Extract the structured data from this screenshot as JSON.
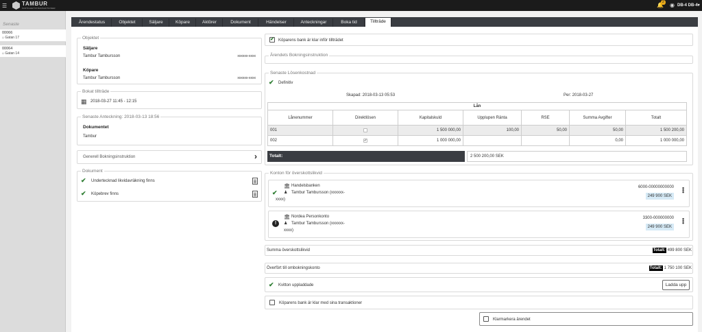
{
  "topbar": {
    "logo_text": "TAMBUR",
    "logo_sub": "FASTIGHETSTRANSAKTIONER",
    "notification_count": "2",
    "user_name": "DB-4 DB-4"
  },
  "sidebar": {
    "title": "Senaste",
    "items": [
      {
        "number": "00066",
        "address": "Gatan 17"
      },
      {
        "number": "00064",
        "address": "Gatan 14"
      }
    ]
  },
  "tabs": [
    {
      "label": "Ärendestatus"
    },
    {
      "label": "Objektet"
    },
    {
      "label": "Säljare"
    },
    {
      "label": "Köpare"
    },
    {
      "label": "Aktörer"
    },
    {
      "label": "Dokument"
    },
    {
      "label": "Händelser"
    },
    {
      "label": "Anteckningar"
    },
    {
      "label": "Boka tid"
    },
    {
      "label": "Tillträde",
      "active": true
    }
  ],
  "objektet": {
    "legend": "Objektet",
    "seller_label": "Säljare",
    "seller_name": "Tambur Tambursson",
    "seller_id": "xxxxxx-xxxx",
    "buyer_label": "Köpare",
    "buyer_name": "Tambur Tambursson",
    "buyer_id": "xxxxxx-xxxx"
  },
  "bokat": {
    "legend": "Bokat tillträde",
    "value": "2018-03-27 11:45 - 12:15"
  },
  "anteckning": {
    "legend": "Senaste Anteckning: 2018-03-13 18:56",
    "title": "Dokumentet",
    "text": "Tambur"
  },
  "generell": {
    "label": "Generell Bokningsinstruktion"
  },
  "dokument": {
    "legend": "Dokument",
    "items": [
      {
        "label": "Undertecknad likvidavräkning finns"
      },
      {
        "label": "Köpebrev finns"
      }
    ]
  },
  "right": {
    "bank_ready_label": "Köparens bank är klar inför tillträdet",
    "arendets_label": "Ärendets Bokningsinstruktion",
    "losen": {
      "legend": "Senaste Lösenkostnad",
      "status": "Definitiv",
      "created": "Skapad: 2018-03-13 05:53",
      "per": "Per: 2018-03-27",
      "table_title": "Lån",
      "headers": [
        "Lånenummer",
        "Direktlösen",
        "Kapitalskuld",
        "Upplupen Ränta",
        "RSE",
        "Summa Avgifter",
        "Totalt"
      ],
      "rows": [
        {
          "nr": "001",
          "direkt": false,
          "kapital": "1 500 000,00",
          "ranta": "100,00",
          "rse": "50,00",
          "avgifter": "50,00",
          "totalt": "1 500 200,00"
        },
        {
          "nr": "002",
          "direkt": true,
          "kapital": "1 000 000,00",
          "ranta": "",
          "rse": "",
          "avgifter": "0,00",
          "totalt": "1 000 000,00"
        }
      ],
      "total_label": "Totalt:",
      "total_value": "2 500 200,00 SEK"
    },
    "konton": {
      "legend": "Konton för överskottslikvid",
      "accounts": [
        {
          "bank": "Handelsbanken",
          "owner": "Tambur Tambursson (xxxxxx-",
          "owner_cont": "xxxx)",
          "number": "6000-00000000000",
          "amount": "249 900 SEK",
          "status": "ok"
        },
        {
          "bank": "Nordea Personkonto",
          "owner": "Tambur Tambursson (xxxxxx-",
          "owner_cont": "xxxx)",
          "number": "3300-000000000",
          "amount": "249 900 SEK",
          "status": "warn"
        }
      ]
    },
    "summa": {
      "label": "Summa överskottslikvid",
      "total_label": "Totalt:",
      "value": "499 800 SEK"
    },
    "overfort": {
      "label": "Överfört till ombokningskonto",
      "total_label": "Totalt:",
      "value": "1 750 100 SEK"
    },
    "kvitton": {
      "label": "Kvitton uppladdade",
      "button": "Ladda upp"
    },
    "bank_trans_label": "Köparens bank är klar med sina transaktioner",
    "klarmarkera_label": "Klarmarkera ärendet"
  }
}
